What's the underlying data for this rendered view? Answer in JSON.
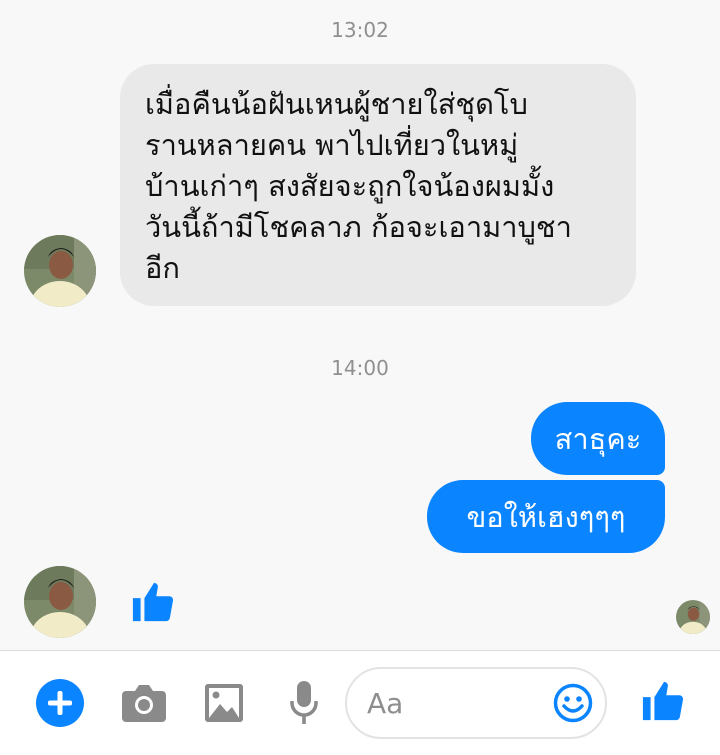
{
  "conversation": {
    "timestamps": [
      "13:02",
      "14:00"
    ],
    "incoming_message": {
      "lines": [
        "เมื่อคืนน้อฝันเหนผู้ชายใส่ชุดโบ",
        "รานหลายคน พาไปเที่ยวในหมู่",
        "บ้านเก่าๆ สงสัยจะถูกใจน้องผมมั้ง",
        "วันนี้ถ้ามีโชคลาภ ก้อจะเอามาบูชา",
        "อีก"
      ]
    },
    "outgoing_messages": [
      "สาธุคะ",
      "ขอให้เฮงๆๆๆ"
    ]
  },
  "composer": {
    "input_placeholder": "Aa",
    "icons": [
      "plus-icon",
      "camera-icon",
      "image-icon",
      "microphone-icon",
      "emoji-icon",
      "like-icon"
    ]
  },
  "colors": {
    "accent": "#0b84ff",
    "incoming_bubble": "#e9e9e9",
    "background": "#f8f8f8"
  }
}
